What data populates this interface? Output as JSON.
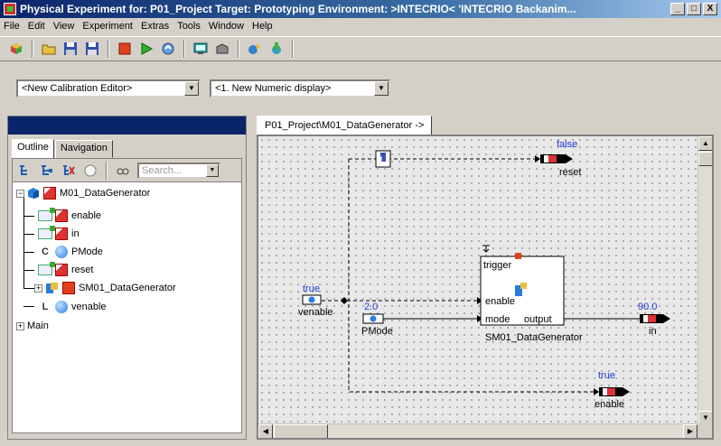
{
  "window": {
    "title": "Physical Experiment for: P01_Project  Target: Prototyping  Environment: >INTECRIO<  'INTECRIO Backanim...",
    "minimize": "_",
    "maximize": "□",
    "close": "X"
  },
  "menu": [
    "File",
    "Edit",
    "View",
    "Experiment",
    "Extras",
    "Tools",
    "Window",
    "Help"
  ],
  "editors": {
    "calibration": "<New Calibration Editor>",
    "numeric": "<1. New Numeric display>"
  },
  "left_tabs": {
    "outline": "Outline",
    "navigation": "Navigation"
  },
  "search": {
    "placeholder": "Search..."
  },
  "tree": {
    "root": "M01_DataGenerator",
    "children": [
      "enable",
      "in",
      "PMode",
      "reset",
      "SM01_DataGenerator",
      "venable"
    ],
    "main": "Main"
  },
  "doc_tab": "P01_Project\\M01_DataGenerator ->",
  "diagram": {
    "false_label": "false",
    "reset_label": "reset",
    "true_label_left": "true",
    "venable_label": "venable",
    "value_20": "2.0",
    "pmode_label": "PMode",
    "trigger_label": "trigger",
    "enable_port": "enable",
    "mode_port": "mode",
    "output_port": "output",
    "block_name": "SM01_DataGenerator",
    "value_90": "90.0",
    "in_label": "in",
    "true_label_bottom": "true",
    "enable_label": "enable",
    "exclaim": "!"
  }
}
